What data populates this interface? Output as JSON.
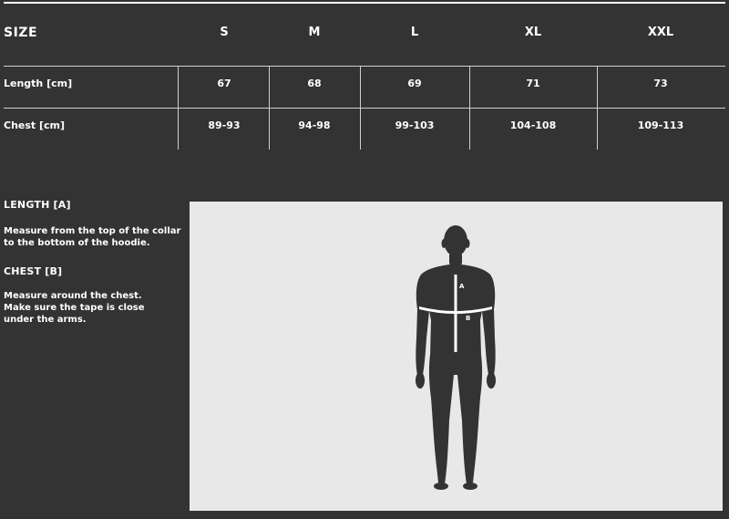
{
  "table": {
    "size_label": "SIZE",
    "sizes": [
      "S",
      "M",
      "L",
      "XL",
      "XXL"
    ],
    "rows": [
      {
        "label": "Length [cm]",
        "values": [
          "67",
          "68",
          "69",
          "71",
          "73"
        ]
      },
      {
        "label": "Chest [cm]",
        "values": [
          "89-93",
          "94-98",
          "99-103",
          "104-108",
          "109-113"
        ]
      }
    ]
  },
  "guide": {
    "length_title": "LENGTH [A]",
    "length_line1": "Measure from the top of the collar",
    "length_line2": "to the bottom of the hoodie.",
    "chest_title": "CHEST [B]",
    "chest_line1": "Measure around the chest.",
    "chest_line2": "Make sure the tape is close",
    "chest_line3": "under the arms."
  },
  "figure": {
    "label_a": "A",
    "label_b": "B",
    "colors": {
      "body": "#333333",
      "panel": "#e8e8e8",
      "marker": "#ffffff"
    }
  }
}
